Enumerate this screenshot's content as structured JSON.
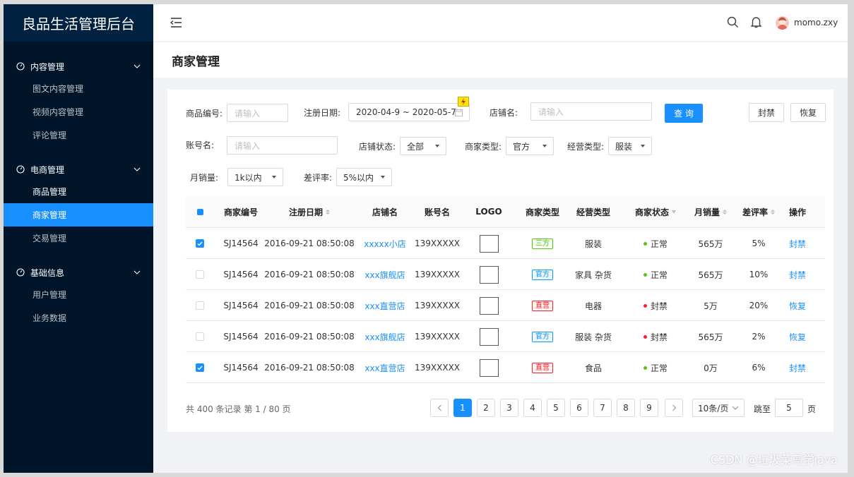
{
  "app": {
    "title": "良品生活管理后台"
  },
  "sidebar": {
    "groups": [
      {
        "label": "内容管理",
        "items": [
          "图文内容管理",
          "视频内容管理",
          "评论管理"
        ]
      },
      {
        "label": "电商管理",
        "items": [
          "商品管理",
          "商家管理",
          "交易管理"
        ]
      },
      {
        "label": "基础信息",
        "items": [
          "用户管理",
          "业务数据"
        ]
      }
    ]
  },
  "header": {
    "username": "momo.zxy"
  },
  "page": {
    "title": "商家管理"
  },
  "filters": {
    "product_no_label": "商品编号:",
    "product_no_placeholder": "请输入",
    "reg_date_label": "注册日期:",
    "reg_date_value": "2020-04-9 ~ 2020-05-7",
    "shop_name_label": "店铺名:",
    "shop_name_placeholder": "请输入",
    "search_label": "查 询",
    "ban_label": "封禁",
    "restore_label": "恢复",
    "account_label": "账号名:",
    "account_placeholder": "请输入",
    "shop_status_label": "店铺状态:",
    "shop_status_value": "全部",
    "merchant_type_label": "商家类型:",
    "merchant_type_value": "官方",
    "business_type_label": "经营类型:",
    "business_type_value": "服装",
    "monthly_sales_label": "月销量:",
    "monthly_sales_value": "1k以内",
    "bad_rate_label": "差评率:",
    "bad_rate_value": "5%以内"
  },
  "table": {
    "headers": [
      "商家编号",
      "注册日期",
      "店铺名",
      "账号名",
      "LOGO",
      "商家类型",
      "经营类型",
      "商家状态",
      "月销量",
      "差评率",
      "操作"
    ],
    "rows": [
      {
        "checked": true,
        "id": "SJ14564",
        "date": "2016-09-21  08:50:08",
        "shop": "xxxxx小店",
        "account": "139XXXXX",
        "type": "三方",
        "type_color": "green",
        "biz": "服装",
        "status": "正常",
        "status_color": "green",
        "sales": "565万",
        "rate": "5%",
        "action": "封禁"
      },
      {
        "checked": false,
        "id": "SJ14564",
        "date": "2016-09-21  08:50:08",
        "shop": "xxx旗舰店",
        "account": "139XXXXX",
        "type": "官方",
        "type_color": "blue",
        "biz": "家具 杂货",
        "status": "正常",
        "status_color": "green",
        "sales": "565万",
        "rate": "10%",
        "action": "封禁"
      },
      {
        "checked": false,
        "id": "SJ14564",
        "date": "2016-09-21  08:50:08",
        "shop": "xxx直营店",
        "account": "139XXXXX",
        "type": "直营",
        "type_color": "red",
        "biz": "电器",
        "status": "封禁",
        "status_color": "red",
        "sales": "5万",
        "rate": "20%",
        "action": "恢复"
      },
      {
        "checked": false,
        "id": "SJ14564",
        "date": "2016-09-21  08:50:08",
        "shop": "xxx旗舰店",
        "account": "139XXXXX",
        "type": "官方",
        "type_color": "blue",
        "biz": "服装 杂货",
        "status": "封禁",
        "status_color": "red",
        "sales": "565万",
        "rate": "2%",
        "action": "恢复"
      },
      {
        "checked": true,
        "id": "SJ14564",
        "date": "2016-09-21  08:50:08",
        "shop": "xxx直营店",
        "account": "139XXXXX",
        "type": "直营",
        "type_color": "red",
        "biz": "食品",
        "status": "正常",
        "status_color": "green",
        "sales": "0万",
        "rate": "6%",
        "action": "封禁"
      }
    ]
  },
  "pagination": {
    "summary": "共 400 条记录 第 1 / 80 页",
    "pages": [
      "1",
      "2",
      "3",
      "4",
      "5",
      "6",
      "7",
      "8",
      "9"
    ],
    "page_size": "10条/页",
    "goto_label": "跳至",
    "goto_value": "5",
    "page_suffix": "页"
  },
  "watermark": "CSDN @垃圾菜鸟学java",
  "colors": {
    "accent": "#1890ff",
    "sidebar": "#001529",
    "green": "#52c41a",
    "red": "#f5222d"
  }
}
